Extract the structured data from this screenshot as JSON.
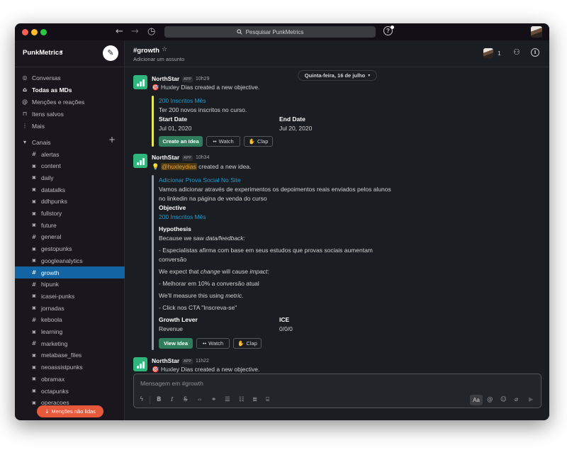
{
  "window": {
    "search_placeholder": "Pesquisar PunkMetrics",
    "search_icon": "magnifier-icon",
    "back_icon": "arrow-left-icon",
    "forward_icon": "arrow-right-icon",
    "history_icon": "clock-icon",
    "help_icon": "question-icon"
  },
  "sidebar": {
    "workspace_name": "PunkMetrics",
    "nav": [
      {
        "label": "Conversas",
        "icon": "threads-icon",
        "bold": false
      },
      {
        "label": "Todas as MDs",
        "icon": "dm-icon",
        "bold": true
      },
      {
        "label": "Menções e reações",
        "icon": "at-icon",
        "bold": false
      },
      {
        "label": "Itens salvos",
        "icon": "bookmark-icon",
        "bold": false
      },
      {
        "label": "Mais",
        "icon": "more-vertical-icon",
        "bold": false
      }
    ],
    "channels_label": "Canais",
    "channels": [
      {
        "name": "alertas",
        "type": "public"
      },
      {
        "name": "content",
        "type": "private"
      },
      {
        "name": "daily",
        "type": "private"
      },
      {
        "name": "datatalks",
        "type": "private"
      },
      {
        "name": "ddhpunks",
        "type": "private"
      },
      {
        "name": "fullstory",
        "type": "private"
      },
      {
        "name": "future",
        "type": "private"
      },
      {
        "name": "general",
        "type": "public"
      },
      {
        "name": "gestopunks",
        "type": "private"
      },
      {
        "name": "googleanalytics",
        "type": "private"
      },
      {
        "name": "growth",
        "type": "public",
        "active": true
      },
      {
        "name": "hipunk",
        "type": "public"
      },
      {
        "name": "icasei-punks",
        "type": "private"
      },
      {
        "name": "jornadas",
        "type": "private"
      },
      {
        "name": "keboola",
        "type": "public"
      },
      {
        "name": "learning",
        "type": "private"
      },
      {
        "name": "marketing",
        "type": "public"
      },
      {
        "name": "metabase_files",
        "type": "private"
      },
      {
        "name": "neoassistpunks",
        "type": "private"
      },
      {
        "name": "obramax",
        "type": "private"
      },
      {
        "name": "octapunks",
        "type": "private"
      },
      {
        "name": "operacoes",
        "type": "private"
      }
    ],
    "unread_button": "Menções não lidas"
  },
  "header": {
    "channel": "#growth",
    "topic": "Adicionar um assunto",
    "member_count": "1"
  },
  "date_divider": "Quinta-feira, 16 de julho",
  "messages": [
    {
      "sender": "NorthStar",
      "badge": "APP",
      "time": "10h29",
      "emoji": "🎯",
      "text": "Huxley Dias created a new objective.",
      "attachment": {
        "title": "200 Inscritos Mês",
        "desc": "Ter 200 novos inscritos no curso.",
        "start_label": "Start Date",
        "start_value": "Jul 01, 2020",
        "end_label": "End Date",
        "end_value": "Jul 20, 2020",
        "buttons": [
          "Create an Idea",
          "Watch",
          "Clap"
        ]
      }
    },
    {
      "sender": "NorthStar",
      "badge": "APP",
      "time": "10h34",
      "emoji": "💡",
      "mention": "@huxleydias",
      "text": "created a new idea.",
      "attachment": {
        "title": "Adicionar Prova Social No Site",
        "desc_line1": "Vamos adicionar através de experimentos os depoimentos reais enviados pelos alunos",
        "desc_line2": "no linkedin na página de venda do curso",
        "objective_label": "Objective",
        "objective_value": "200 Inscritos Mês",
        "hypothesis_label": "Hypothesis",
        "h1_pre": "Because we saw ",
        "h1_em": "data/feedback:",
        "h2": "- Especialistas afirma com base em seus estudos que provas sociais aumentam",
        "h2b": "conversão",
        "h3_pre": "We expect that ",
        "h3_em1": "change",
        "h3_mid": " will cause ",
        "h3_em2": "impact:",
        "h4": "- Melhorar em 10% a conversão atual",
        "h5_pre": "We'll measure this using ",
        "h5_em": "metric.",
        "h6": "- Click nos CTA \"Inscreva-se\"",
        "lever_label": "Growth Lever",
        "lever_value": "Revenue",
        "ice_label": "ICE",
        "ice_value": "0/0/0",
        "buttons": [
          "View Idea",
          "Watch",
          "Clap"
        ]
      }
    },
    {
      "sender": "NorthStar",
      "badge": "APP",
      "time": "11h22",
      "emoji": "🎯",
      "text": "Huxley Dias created a new objective."
    }
  ],
  "composer": {
    "placeholder": "Mensagem em #growth",
    "aa_label": "Aa"
  },
  "colors": {
    "accent": "#1264a3",
    "link": "#1d9bd1",
    "primary_button": "#2f7d5d",
    "unread_button": "#e8583a",
    "app_icon": "#2eb67d",
    "objective_bar": "#e8e65a",
    "idea_bar": "#9aa0a6"
  }
}
